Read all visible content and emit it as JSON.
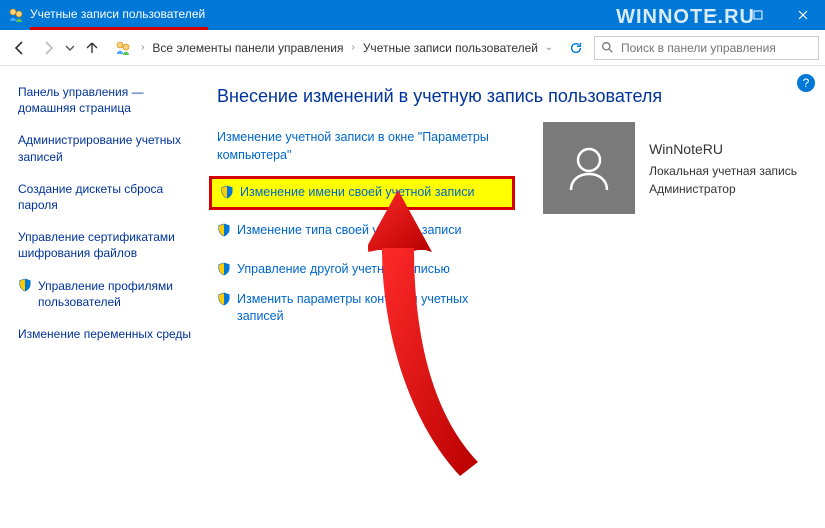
{
  "watermark": "WINNOTE.RU",
  "titlebar": {
    "title": "Учетные записи пользователей"
  },
  "breadcrumb": {
    "root": "Все элементы панели управления",
    "current": "Учетные записи пользователей"
  },
  "search": {
    "placeholder": "Поиск в панели управления"
  },
  "sidebar": {
    "items": [
      {
        "label": "Панель управления — домашняя страница",
        "shield": false
      },
      {
        "label": "Администрирование учетных записей",
        "shield": false
      },
      {
        "label": "Создание дискеты сброса пароля",
        "shield": false
      },
      {
        "label": "Управление сертификатами шифрования файлов",
        "shield": false
      },
      {
        "label": "Управление профилями пользователей",
        "shield": true
      },
      {
        "label": "Изменение переменных среды",
        "shield": false
      }
    ]
  },
  "main": {
    "heading": "Внесение изменений в учетную запись пользователя",
    "tasks": [
      {
        "label": "Изменение учетной записи в окне \"Параметры компьютера\"",
        "shield": false,
        "highlight": false
      },
      {
        "label": "Изменение имени своей учетной записи",
        "shield": true,
        "highlight": true
      },
      {
        "label": "Изменение типа своей учетной записи",
        "shield": true,
        "highlight": false
      },
      {
        "label": "Управление другой учетной записью",
        "shield": true,
        "highlight": false,
        "spaced": true
      },
      {
        "label": "Изменить параметры контроля учетных записей",
        "shield": true,
        "highlight": false
      }
    ]
  },
  "user": {
    "name": "WinNoteRU",
    "type": "Локальная учетная запись",
    "role": "Администратор"
  }
}
